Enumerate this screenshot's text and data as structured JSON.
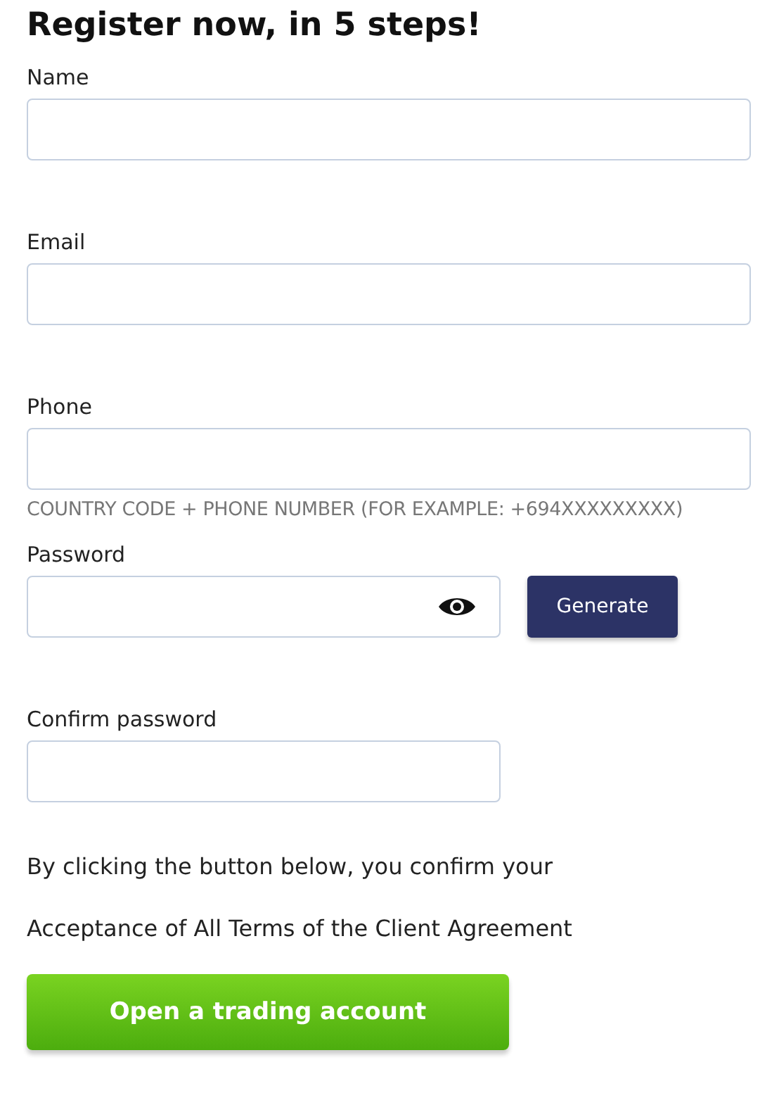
{
  "title": "Register now, in 5 steps!",
  "fields": [
    {
      "kind": "text",
      "label": "Name"
    },
    {
      "kind": "text",
      "label": "Email"
    },
    {
      "kind": "text",
      "label": "Phone",
      "hint": "COUNTRY CODE + PHONE NUMBER (FOR EXAMPLE: +694XXXXXXXXX)"
    },
    {
      "kind": "password",
      "label": "Password",
      "action": "Generate"
    },
    {
      "kind": "confirm",
      "label": "Confirm password"
    }
  ],
  "consent": [
    "By clicking the button below, you confirm your",
    "Acceptance of All Terms of the Client Agreement"
  ],
  "submit": "Open a trading account"
}
